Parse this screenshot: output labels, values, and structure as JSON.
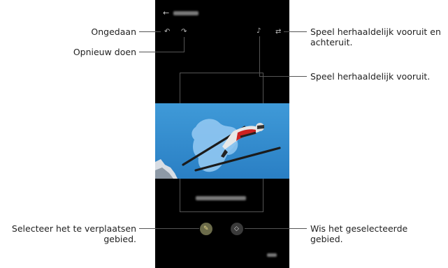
{
  "annotations": {
    "undo": "Ongedaan",
    "redo": "Opnieuw doen",
    "play_forward_backward_1": "Speel herhaaldelijk vooruit en",
    "play_forward_backward_2": "achteruit.",
    "play_forward": "Speel herhaaldelijk vooruit.",
    "select_move_1": "Selecteer het te verplaatsen",
    "select_move_2": "gebied.",
    "erase_1": "Wis het geselecteerde",
    "erase_2": "gebied."
  },
  "icons": {
    "back": "back-arrow-icon",
    "undo": "undo-icon",
    "redo": "redo-icon",
    "play_forward": "play-forward-icon",
    "play_loop": "loop-icon",
    "brush": "brush-icon",
    "eraser": "eraser-icon"
  },
  "colors": {
    "screen_bg": "#000000",
    "sky": "#2f8fd0",
    "selection": "#8cc4ef",
    "brush_button": "#6b6b4a",
    "eraser_button": "#3a3a3a"
  }
}
